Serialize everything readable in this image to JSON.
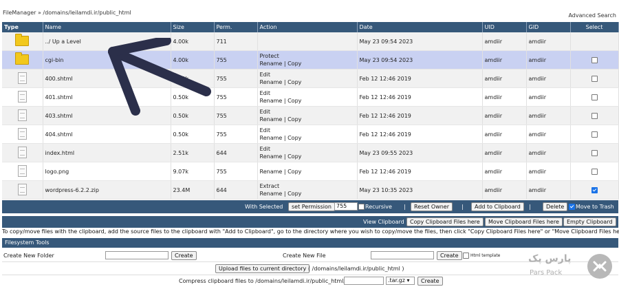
{
  "header": {
    "breadcrumb": "FileManager » /domains/leilamdi.ir/public_html",
    "advanced_search": "Advanced Search"
  },
  "columns": [
    "Type",
    "Name",
    "Size",
    "Perm.",
    "Action",
    "Date",
    "UID",
    "GID",
    "Select"
  ],
  "rows": [
    {
      "type": "folder",
      "name": "../ Up a Level",
      "size": "4.00k",
      "perm": "711",
      "action1": "",
      "action2": "",
      "date": "May 23 09:54 2023",
      "uid": "amdiir",
      "gid": "amdiir",
      "checkbox": false,
      "checked": false
    },
    {
      "type": "folder",
      "name": "cgi-bin",
      "size": "4.00k",
      "perm": "755",
      "action1": "Protect",
      "action2": "Rename | Copy",
      "date": "May 23 09:54 2023",
      "uid": "amdiir",
      "gid": "amdiir",
      "checkbox": true,
      "checked": false
    },
    {
      "type": "file",
      "name": "400.shtml",
      "size": "0.50k",
      "perm": "755",
      "action1": "Edit",
      "action2": "Rename | Copy",
      "date": "Feb 12 12:46 2019",
      "uid": "amdiir",
      "gid": "amdiir",
      "checkbox": true,
      "checked": false
    },
    {
      "type": "file",
      "name": "401.shtml",
      "size": "0.50k",
      "perm": "755",
      "action1": "Edit",
      "action2": "Rename | Copy",
      "date": "Feb 12 12:46 2019",
      "uid": "amdiir",
      "gid": "amdiir",
      "checkbox": true,
      "checked": false
    },
    {
      "type": "file",
      "name": "403.shtml",
      "size": "0.50k",
      "perm": "755",
      "action1": "Edit",
      "action2": "Rename | Copy",
      "date": "Feb 12 12:46 2019",
      "uid": "amdiir",
      "gid": "amdiir",
      "checkbox": true,
      "checked": false
    },
    {
      "type": "file",
      "name": "404.shtml",
      "size": "0.50k",
      "perm": "755",
      "action1": "Edit",
      "action2": "Rename | Copy",
      "date": "Feb 12 12:46 2019",
      "uid": "amdiir",
      "gid": "amdiir",
      "checkbox": true,
      "checked": false
    },
    {
      "type": "file",
      "name": "index.html",
      "size": "2.51k",
      "perm": "644",
      "action1": "Edit",
      "action2": "Rename | Copy",
      "date": "May 23 09:55 2023",
      "uid": "amdiir",
      "gid": "amdiir",
      "checkbox": true,
      "checked": false
    },
    {
      "type": "file",
      "name": "logo.png",
      "size": "9.07k",
      "perm": "755",
      "action1": "",
      "action2": "Rename | Copy",
      "date": "Feb 12 12:46 2019",
      "uid": "amdiir",
      "gid": "amdiir",
      "checkbox": true,
      "checked": false
    },
    {
      "type": "file",
      "name": "wordpress-6.2.2.zip",
      "size": "23.4M",
      "perm": "644",
      "action1": "Extract",
      "action2": "Rename | Copy",
      "date": "May 23 10:35 2023",
      "uid": "amdiir",
      "gid": "amdiir",
      "checkbox": true,
      "checked": true
    }
  ],
  "selected_bar": {
    "label": "With Selected",
    "set_permission": "set Permission",
    "perm_value": "755",
    "recursive": "Recursive",
    "reset_owner": "Reset Owner",
    "add_clipboard": "Add to Clipboard",
    "sep": "|",
    "delete": "Delete",
    "move_trash": "Move to Trash"
  },
  "clipboard_bar": {
    "label": "View Clipboard",
    "copy_here": "Copy Clipboard Files here",
    "move_here": "Move Clipboard Files here",
    "empty": "Empty Clipboard"
  },
  "note": "To copy/move files with the clipboard, add the source files to the clipboard with \"Add to Clipboard\", go to the directory where you wish to copy/move the files, then click \"Copy Clipboard Files here\" or \"Move Clipboard Files here\"",
  "filesystem": {
    "title": "Filesystem Tools",
    "new_folder": "Create New Folder",
    "new_file": "Create New File",
    "create": "Create",
    "html_template": "Html template",
    "upload": "Upload files to current directory",
    "upload_path": "( /domains/leilamdi.ir/public_html )",
    "compress": "Compress clipboard files to /domains/leilamdi.ir/public_html/",
    "ext": ".tar.gz"
  },
  "watermark": {
    "fa": "پارس پک",
    "en": "Pars Pack"
  },
  "colors": {
    "header_bg": "#36587a",
    "highlight_row": "#c9d1f2",
    "arrow": "#2b2f4a",
    "checked": "#1a73e8"
  }
}
